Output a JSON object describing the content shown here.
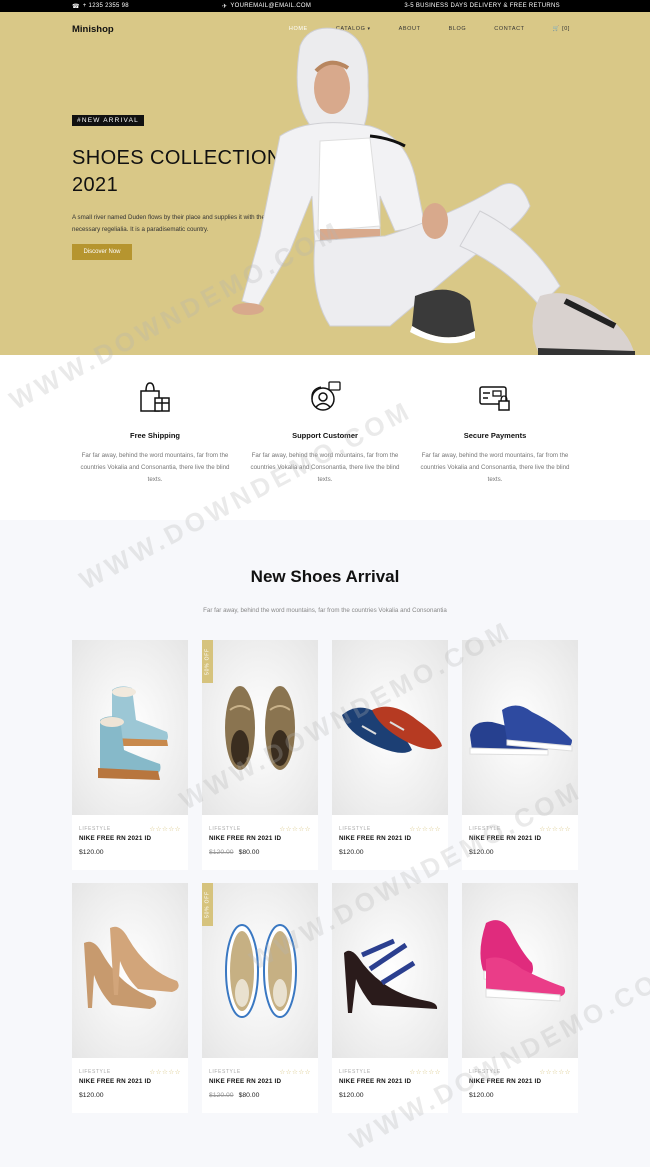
{
  "topbar": {
    "phone": "+ 1235 2355 98",
    "email": "YOUREMAIL@EMAIL.COM",
    "notice": "3-5 BUSINESS DAYS DELIVERY & FREE RETURNS"
  },
  "nav": {
    "brand": "Minishop",
    "items": [
      {
        "label": "HOME"
      },
      {
        "label": "CATALOG"
      },
      {
        "label": "ABOUT"
      },
      {
        "label": "BLOG"
      },
      {
        "label": "CONTACT"
      }
    ],
    "cart": "[0]"
  },
  "hero": {
    "badge": "#NEW ARRIVAL",
    "title_line1": "SHOES COLLECTION",
    "title_line2": "2021",
    "description": "A small river named Duden flows by their place and supplies it with the necessary regelialia. It is a paradisematic country.",
    "cta": "Discover Now",
    "bg_color": "#d9c887"
  },
  "features": [
    {
      "icon": "gift-bag-icon",
      "title": "Free Shipping",
      "desc": "Far far away, behind the word mountains, far from the countries Vokalia and Consonantia, there live the blind texts."
    },
    {
      "icon": "support-agent-icon",
      "title": "Support Customer",
      "desc": "Far far away, behind the word mountains, far from the countries Vokalia and Consonantia, there live the blind texts."
    },
    {
      "icon": "secure-payment-icon",
      "title": "Secure Payments",
      "desc": "Far far away, behind the word mountains, far from the countries Vokalia and Consonantia, there live the blind texts."
    }
  ],
  "products": {
    "title": "New Shoes Arrival",
    "subtitle": "Far far away, behind the word mountains, far from the countries Vokalia and Consonantia",
    "stars": "☆☆☆☆☆",
    "items": [
      {
        "image": "ankle-boots",
        "category": "LIFESTYLE",
        "name": "NIKE FREE RN 2021 ID",
        "price": "$120.00",
        "old_price": null,
        "badge": null
      },
      {
        "image": "suede-boat-shoes",
        "category": "LIFESTYLE",
        "name": "NIKE FREE RN 2021 ID",
        "price": "$80.00",
        "old_price": "$120.00",
        "badge": "50% OFF"
      },
      {
        "image": "loafers",
        "category": "LIFESTYLE",
        "name": "NIKE FREE RN 2021 ID",
        "price": "$120.00",
        "old_price": null,
        "badge": null
      },
      {
        "image": "blue-sneakers",
        "category": "LIFESTYLE",
        "name": "NIKE FREE RN 2021 ID",
        "price": "$120.00",
        "old_price": null,
        "badge": null
      },
      {
        "image": "nude-pumps",
        "category": "LIFESTYLE",
        "name": "NIKE FREE RN 2021 ID",
        "price": "$120.00",
        "old_price": null,
        "badge": null
      },
      {
        "image": "canvas-sneakers",
        "category": "LIFESTYLE",
        "name": "NIKE FREE RN 2021 ID",
        "price": "$80.00",
        "old_price": "$120.00",
        "badge": "50% OFF"
      },
      {
        "image": "strappy-heels",
        "category": "LIFESTYLE",
        "name": "NIKE FREE RN 2021 ID",
        "price": "$120.00",
        "old_price": null,
        "badge": null
      },
      {
        "image": "pink-runners",
        "category": "LIFESTYLE",
        "name": "NIKE FREE RN 2021 ID",
        "price": "$120.00",
        "old_price": null,
        "badge": null
      }
    ]
  },
  "watermark": "WWW.DOWNDEMO.COM",
  "colors": {
    "accent": "#b6952f",
    "badge": "#d6c37d",
    "hero": "#d9c887"
  }
}
